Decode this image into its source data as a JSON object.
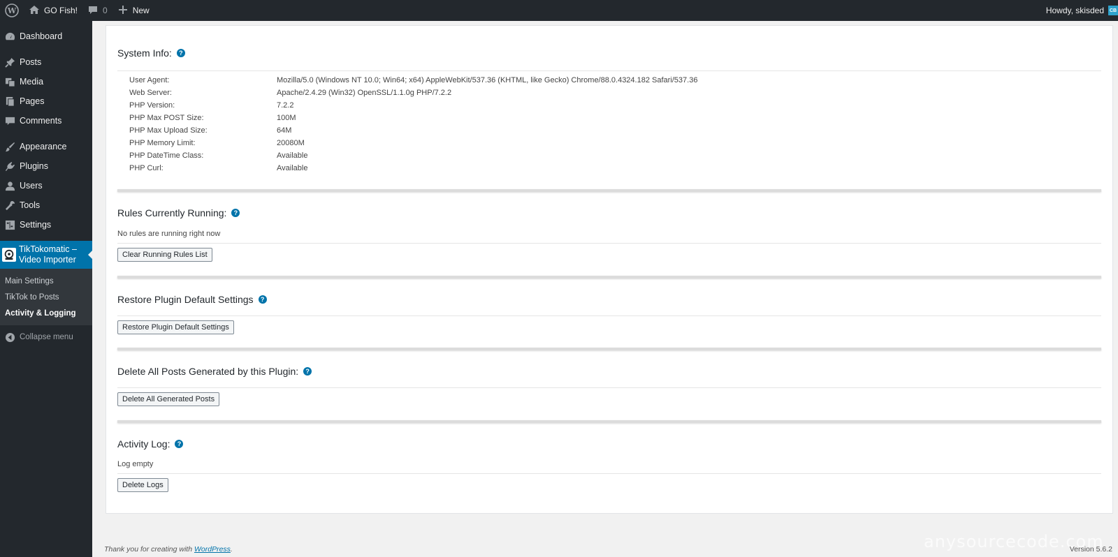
{
  "adminbar": {
    "site_name": "GO Fish!",
    "comments_count": "0",
    "new_label": "New",
    "howdy": "Howdy, skisded",
    "avatar_text": "CB"
  },
  "sidebar": {
    "items": [
      {
        "label": "Dashboard",
        "icon": "dashboard-icon"
      },
      {
        "label": "Posts",
        "icon": "pin-icon"
      },
      {
        "label": "Media",
        "icon": "media-icon"
      },
      {
        "label": "Pages",
        "icon": "pages-icon"
      },
      {
        "label": "Comments",
        "icon": "comment-icon"
      },
      {
        "label": "Appearance",
        "icon": "brush-icon"
      },
      {
        "label": "Plugins",
        "icon": "plugin-icon"
      },
      {
        "label": "Users",
        "icon": "user-icon"
      },
      {
        "label": "Tools",
        "icon": "wrench-icon"
      },
      {
        "label": "Settings",
        "icon": "settings-icon"
      }
    ],
    "active_plugin": "TikTokomatic – Video Importer",
    "active_plugin_line1": "TikTokomatic –",
    "active_plugin_line2": "Video Importer",
    "submenu": [
      "Main Settings",
      "TikTok to Posts",
      "Activity & Logging"
    ],
    "collapse": "Collapse menu"
  },
  "system_info": {
    "title": "System Info:",
    "rows": [
      {
        "label": "User Agent:",
        "value": "Mozilla/5.0 (Windows NT 10.0; Win64; x64) AppleWebKit/537.36 (KHTML, like Gecko) Chrome/88.0.4324.182 Safari/537.36"
      },
      {
        "label": "Web Server:",
        "value": "Apache/2.4.29 (Win32) OpenSSL/1.1.0g PHP/7.2.2"
      },
      {
        "label": "PHP Version:",
        "value": "7.2.2"
      },
      {
        "label": "PHP Max POST Size:",
        "value": "100M"
      },
      {
        "label": "PHP Max Upload Size:",
        "value": "64M"
      },
      {
        "label": "PHP Memory Limit:",
        "value": "20080M"
      },
      {
        "label": "PHP DateTime Class:",
        "value": "Available"
      },
      {
        "label": "PHP Curl:",
        "value": "Available"
      }
    ]
  },
  "rules": {
    "title": "Rules Currently Running:",
    "status": "No rules are running right now",
    "button": "Clear Running Rules List"
  },
  "restore": {
    "title": "Restore Plugin Default Settings",
    "button": "Restore Plugin Default Settings"
  },
  "delete_posts": {
    "title": "Delete All Posts Generated by this Plugin:",
    "button": "Delete All Generated Posts"
  },
  "activity": {
    "title": "Activity Log:",
    "status": "Log empty",
    "button": "Delete Logs"
  },
  "footer": {
    "thanks_prefix": "Thank you for creating with",
    "wp_link": "WordPress",
    "thanks_suffix": ".",
    "version": "Version 5.6.2"
  },
  "watermark": "anysourcecode.com",
  "help_glyph": "?"
}
